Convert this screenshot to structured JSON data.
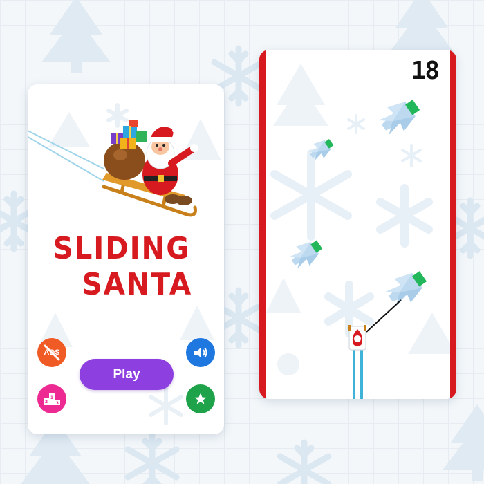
{
  "menu": {
    "title_line1": "SLIDING",
    "title_line2": "SANTA",
    "play_label": "Play",
    "ads_label": "ADS",
    "icons": {
      "ads": "no-ads-icon",
      "leaderboard": "podium-icon",
      "sound": "speaker-icon",
      "rate": "star-icon",
      "hero": "santa-on-sled-icon"
    }
  },
  "game": {
    "score": "18",
    "obstacle_icon": "ice-pine-tree-icon",
    "player_icon": "santa-sled-topdown-icon"
  },
  "colors": {
    "title_red": "#d71920",
    "play_purple": "#8e3fe0",
    "ads_orange": "#f05a24",
    "leader_pink": "#ec2a91",
    "sound_blue": "#1e78e0",
    "rate_green": "#1fa34a",
    "wall_red": "#d71920",
    "trail_cyan": "#3fb2d8",
    "ice_blue": "#bcd9f0",
    "tree_top_green": "#21b75a"
  }
}
